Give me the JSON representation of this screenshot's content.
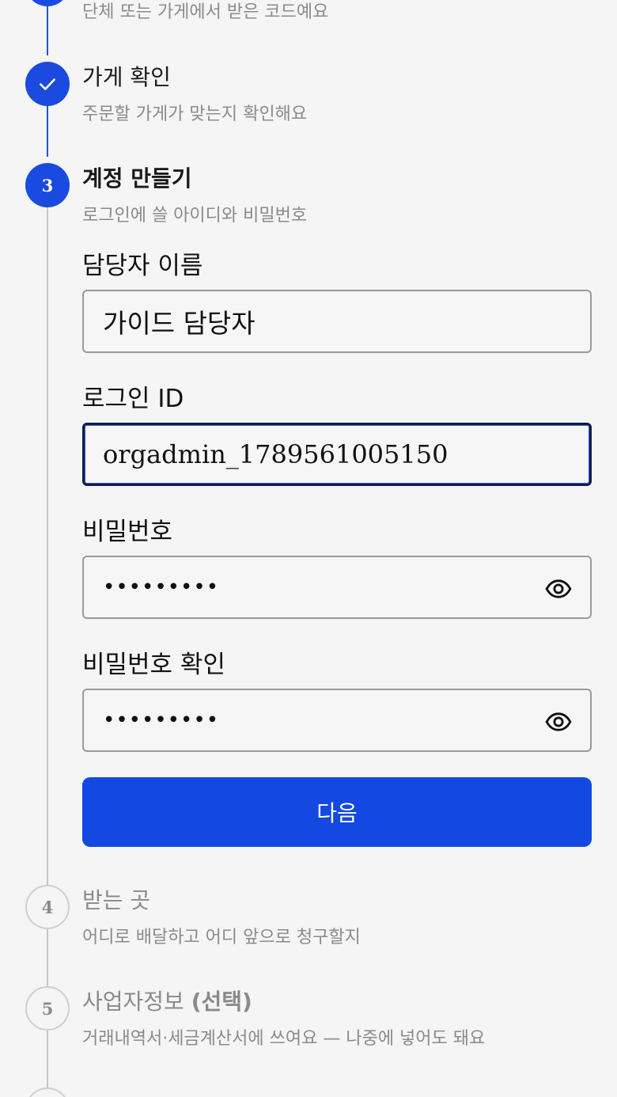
{
  "steps": [
    {
      "subtitle": "단체 또는 가게에서 받은 코드예요"
    },
    {
      "title": "가게 확인",
      "subtitle": "주문할 가게가 맞는지 확인해요"
    },
    {
      "number": "3",
      "title": "계정 만들기",
      "subtitle": "로그인에 쓸 아이디와 비밀번호"
    },
    {
      "number": "4",
      "title": "받는 곳",
      "subtitle": "어디로 배달하고 어디 앞으로 청구할지"
    },
    {
      "number": "5",
      "title_main": "사업자정보 ",
      "title_optional": "(선택)",
      "subtitle": "거래내역서·세금계산서에 쓰여요 — 나중에 넣어도 돼요"
    }
  ],
  "form": {
    "name_label": "담당자 이름",
    "name_value": "가이드 담당자",
    "login_id_label": "로그인 ID",
    "login_id_value": "orgadmin_1789561005150",
    "password_label": "비밀번호",
    "password_value": "•••••••••",
    "password_confirm_label": "비밀번호 확인",
    "password_confirm_value": "•••••••••",
    "next_label": "다음"
  },
  "colors": {
    "accent": "#1448e3",
    "step_line_active": "#1a56db",
    "step_line_inactive": "#c7c7c7",
    "muted_text": "#8a8a8a"
  },
  "icons": {
    "step_done": "check-icon",
    "show_password": "eye-icon"
  }
}
